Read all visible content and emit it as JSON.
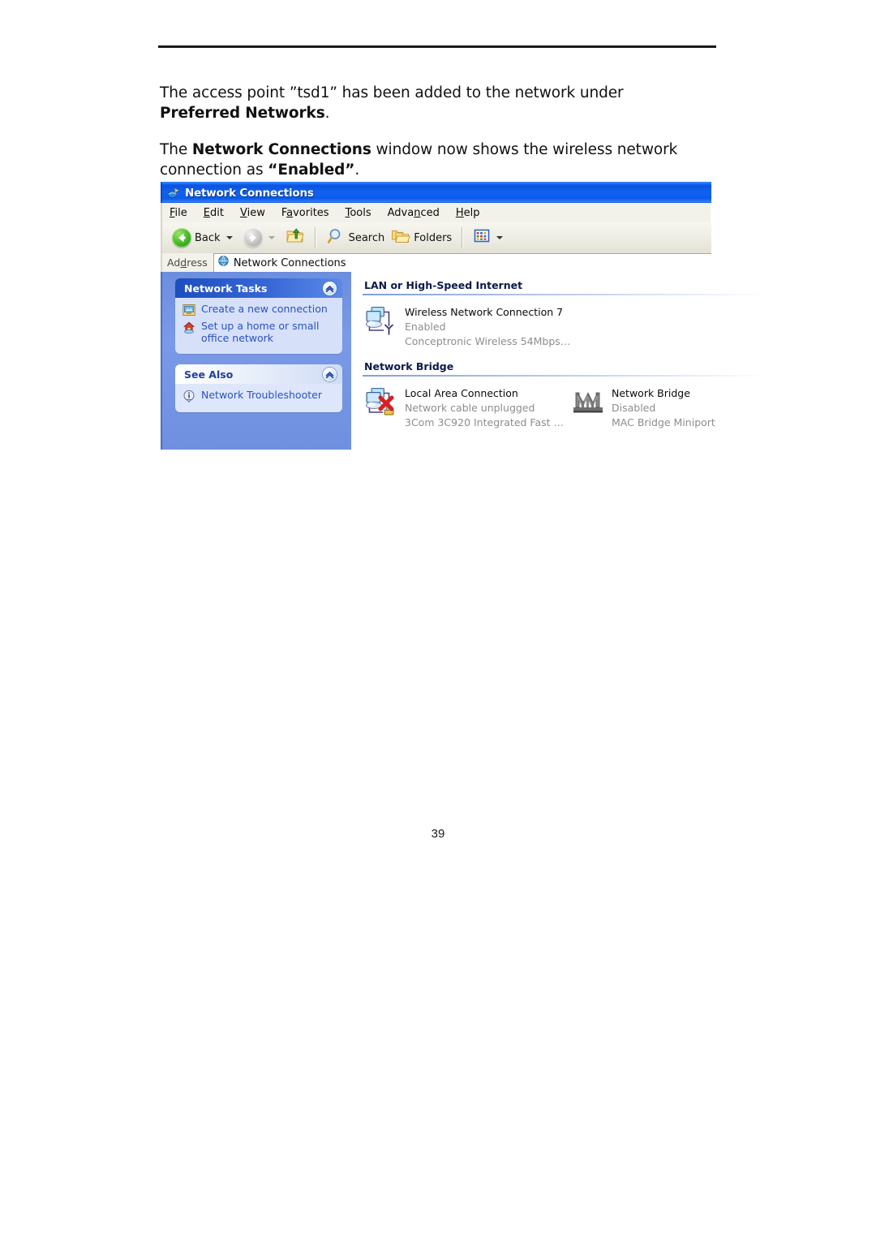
{
  "page": {
    "number": "39",
    "paragraphs": [
      {
        "id": "p1",
        "segments": [
          {
            "text": "The access point ”tsd1” has been added to the network under ",
            "bold": false
          },
          {
            "text": "Preferred Networks",
            "bold": true
          },
          {
            "text": ".",
            "bold": false
          }
        ]
      },
      {
        "id": "p2",
        "segments": [
          {
            "text": "The ",
            "bold": false
          },
          {
            "text": "Network Connections",
            "bold": true
          },
          {
            "text": " window now shows the wireless network connection as ",
            "bold": false
          },
          {
            "text": "“Enabled”",
            "bold": true
          },
          {
            "text": ".",
            "bold": false
          }
        ]
      }
    ]
  },
  "window": {
    "title": "Network Connections",
    "title_icon": "network-connections-icon",
    "menu": [
      {
        "label": "File",
        "accel": "F"
      },
      {
        "label": "Edit",
        "accel": "E"
      },
      {
        "label": "View",
        "accel": "V"
      },
      {
        "label": "Favorites",
        "accel": "a"
      },
      {
        "label": "Tools",
        "accel": "T"
      },
      {
        "label": "Advanced",
        "accel": "n"
      },
      {
        "label": "Help",
        "accel": "H"
      }
    ],
    "toolbar": {
      "back_label": "Back",
      "search_label": "Search",
      "folders_label": "Folders",
      "icons": [
        "back-arrow-icon",
        "forward-arrow-icon",
        "up-folder-icon",
        "search-icon",
        "folders-icon",
        "views-icon"
      ]
    },
    "address": {
      "label": "Address",
      "value": "Network Connections",
      "icon": "network-globe-icon"
    }
  },
  "sidebar": {
    "panels": [
      {
        "title": "Network Tasks",
        "collapse_icon": "chevron-up-icon",
        "items": [
          {
            "label": "Create a new connection",
            "icon": "new-connection-icon"
          },
          {
            "label": "Set up a home or small office network",
            "icon": "home-network-icon"
          }
        ]
      },
      {
        "title": "See Also",
        "collapse_icon": "chevron-up-icon",
        "items": [
          {
            "label": "Network Troubleshooter",
            "icon": "info-icon"
          }
        ]
      }
    ]
  },
  "content": {
    "groups": [
      {
        "heading": "LAN or High-Speed Internet",
        "items": [
          {
            "name": "Wireless Network Connection 7",
            "status": "Enabled",
            "device": "Conceptronic Wireless 54Mbps…",
            "icon": "wireless-connection-icon"
          }
        ]
      },
      {
        "heading": "Network Bridge",
        "items": [
          {
            "name": "Local Area Connection",
            "status": "Network cable unplugged",
            "device": "3Com 3C920 Integrated Fast …",
            "icon": "lan-disconnected-icon"
          },
          {
            "name": "Network Bridge",
            "status": "Disabled",
            "device": "MAC Bridge Miniport",
            "icon": "bridge-icon"
          }
        ]
      }
    ]
  },
  "colors": {
    "titlebar_blue": "#0d5bec",
    "sidebar_blue": "#7a9ae6",
    "panel_header_blue": "#1e4ebd",
    "link_blue": "#2b52c4",
    "muted_gray": "#8d8d8d"
  }
}
